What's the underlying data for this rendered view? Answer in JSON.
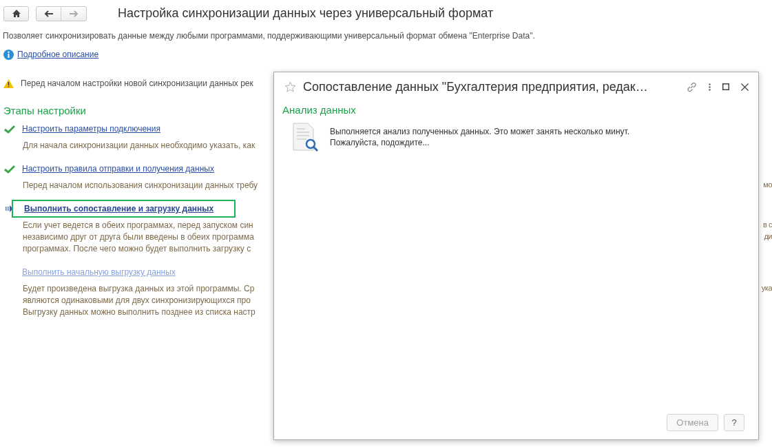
{
  "nav": {
    "back_disabled": false,
    "forward_disabled": true
  },
  "title": "Настройка синхронизации данных через универсальный формат",
  "description": "Позволяет синхронизировать данные между любыми программами, поддерживающими универсальный формат обмена \"Enterprise Data\".",
  "info_link": "Подробное описание",
  "warning": "Перед началом настройки новой синхронизации данных рек",
  "stages_title": "Этапы настройки",
  "steps": [
    {
      "title": "Настроить параметры подключения",
      "kind": "done",
      "lines": [
        {
          "left": "Для начала синхронизации данных необходимо указать, как"
        }
      ]
    },
    {
      "title": "Настроить правила отправки и получения данных",
      "kind": "done",
      "lines": [
        {
          "left": "Перед началом использования синхронизации данных требу",
          "right": "мо"
        }
      ]
    },
    {
      "title": "Выполнить сопоставление и загрузку данных",
      "kind": "current",
      "lines": [
        {
          "left": "Если учет ведется в обеих программах, перед запуском син",
          "right": "в с"
        },
        {
          "left": "независимо друг от друга были введены в обеих программа",
          "right": "ди"
        },
        {
          "left": "программах. После чего можно будет выполнить загрузку с"
        }
      ]
    },
    {
      "title": "Выполнить начальную выгрузку данных",
      "kind": "pending",
      "lines": [
        {
          "left": "Будет произведена выгрузка данных из этой программы. Ср",
          "right": "ука"
        },
        {
          "left": "являются одинаковыми для двух синхронизирующихся про"
        },
        {
          "left": "Выгрузку данных можно выполнить позднее из списка настр"
        }
      ]
    }
  ],
  "dialog": {
    "title": "Сопоставление данных \"Бухгалтерия предприятия, редак…",
    "favorite": false,
    "section": "Анализ данных",
    "message_lines": [
      "Выполняется анализ полученных данных. Это может занять несколько минут.",
      "Пожалуйста, подождите..."
    ],
    "buttons": [
      {
        "label": "Отмена",
        "disabled": true
      },
      {
        "label": "?",
        "disabled": false
      }
    ]
  }
}
